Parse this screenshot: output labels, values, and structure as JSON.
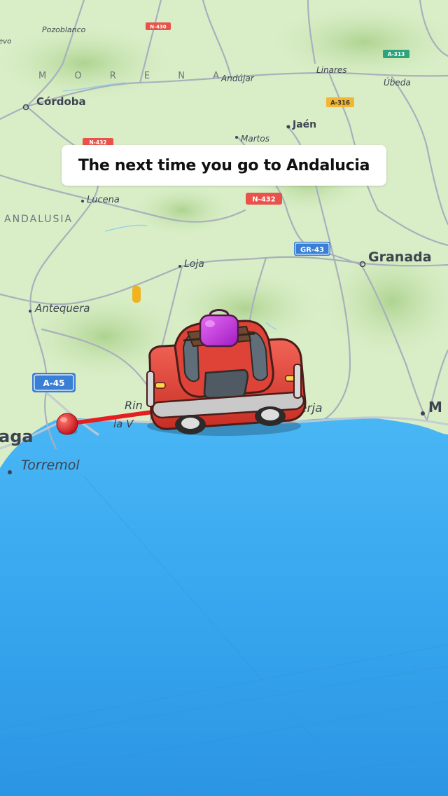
{
  "caption": "The next time you go to Andalucia",
  "map": {
    "region_label": "ANDALUSIA",
    "mountain_label": "M O R E N A",
    "places": {
      "pozoblanco": "Pozoblanco",
      "cordoba": "Córdoba",
      "andujar": "Andújar",
      "linares": "Linares",
      "ubeda": "Úbeda",
      "jaen": "Jaén",
      "martos": "Martos",
      "lucena": "Lucena",
      "loja": "Loja",
      "granada": "Granada",
      "antequera": "Antequera",
      "malaga_partial": "aga",
      "torremolinos_partial": "Torremol",
      "rincon_partial": "Rin",
      "la_vinuela_partial": "la V",
      "nerja_partial": "erja",
      "motril_partial": "M",
      "far_left_partial": "evo"
    },
    "road_shields": {
      "n430": "N-430",
      "a316": "A-316",
      "a313": "A-313",
      "n432_top": "N-432",
      "n432": "N-432",
      "gr43": "GR-43",
      "a45": "A-45"
    },
    "colors": {
      "land": "#d9eec7",
      "sea": "#3aa9ef",
      "route": "#e31f1f",
      "car_body": "#e8453a",
      "luggage": "#c23be0"
    }
  }
}
